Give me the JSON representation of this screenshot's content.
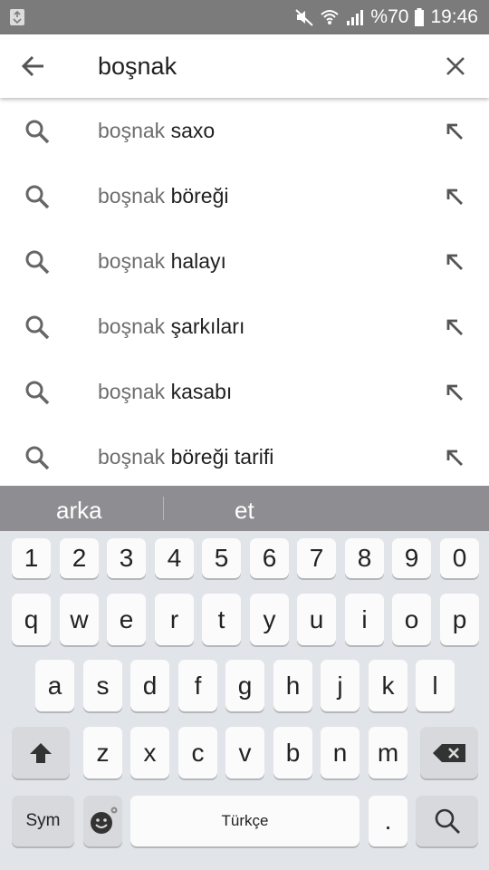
{
  "status_bar": {
    "battery_percent": "%70",
    "time": "19:46"
  },
  "search": {
    "query": "boşnak"
  },
  "suggestions": [
    {
      "query": "boşnak",
      "completion": "saxo"
    },
    {
      "query": "boşnak",
      "completion": "böreği"
    },
    {
      "query": "boşnak",
      "completion": "halayı"
    },
    {
      "query": "boşnak",
      "completion": "şarkıları"
    },
    {
      "query": "boşnak",
      "completion": "kasabı"
    },
    {
      "query": "boşnak",
      "completion": "böreği tarifi"
    }
  ],
  "keyboard": {
    "predictions": [
      "arka",
      "et"
    ],
    "number_row": [
      "1",
      "2",
      "3",
      "4",
      "5",
      "6",
      "7",
      "8",
      "9",
      "0"
    ],
    "row1": [
      "q",
      "w",
      "e",
      "r",
      "t",
      "y",
      "u",
      "i",
      "o",
      "p"
    ],
    "row2": [
      "a",
      "s",
      "d",
      "f",
      "g",
      "h",
      "j",
      "k",
      "l"
    ],
    "row3": [
      "z",
      "x",
      "c",
      "v",
      "b",
      "n",
      "m"
    ],
    "sym_label": "Sym",
    "space_label": "Türkçe",
    "period_label": "."
  }
}
